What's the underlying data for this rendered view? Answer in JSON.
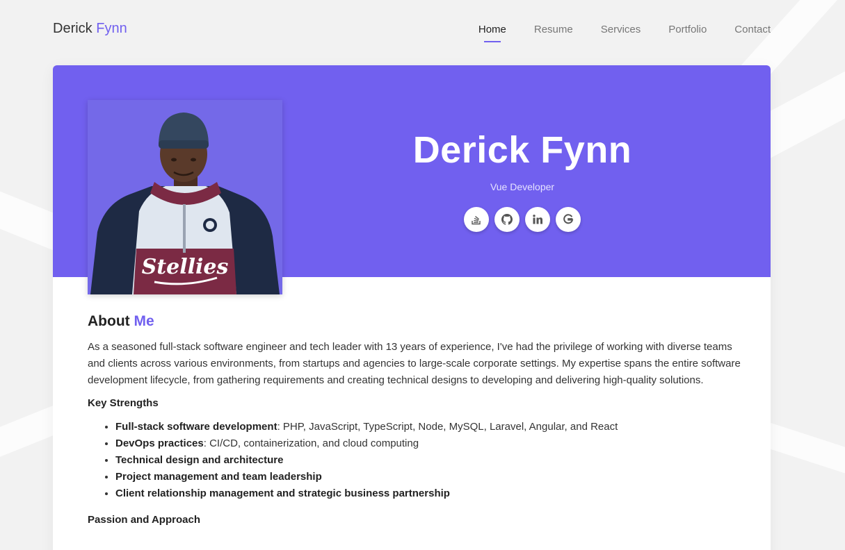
{
  "header": {
    "brand_first": "Derick",
    "brand_last": "Fynn",
    "nav": [
      {
        "label": "Home",
        "active": true
      },
      {
        "label": "Resume",
        "active": false
      },
      {
        "label": "Services",
        "active": false
      },
      {
        "label": "Portfolio",
        "active": false
      },
      {
        "label": "Contact",
        "active": false
      }
    ]
  },
  "hero": {
    "name": "Derick Fynn",
    "role": "Vue Developer",
    "photo_alt": "Stellies",
    "socials": [
      {
        "icon": "stackoverflow-icon"
      },
      {
        "icon": "github-icon"
      },
      {
        "icon": "linkedin-icon"
      },
      {
        "icon": "google-icon"
      }
    ]
  },
  "about": {
    "title_first": "About",
    "title_accent": "Me",
    "intro": "As a seasoned full-stack software engineer and tech leader with 13 years of experience, I've had the privilege of working with diverse teams and clients across various environments, from startups and agencies to large-scale corporate settings. My expertise spans the entire software development lifecycle, from gathering requirements and creating technical designs to developing and delivering high-quality solutions.",
    "strengths_title": "Key Strengths",
    "strengths": [
      {
        "bold": "Full-stack software development",
        "rest": ": PHP, JavaScript, TypeScript, Node, MySQL, Laravel, Angular, and React"
      },
      {
        "bold": "DevOps practices",
        "rest": ": CI/CD, containerization, and cloud computing"
      },
      {
        "bold": "Technical design and architecture",
        "rest": ""
      },
      {
        "bold": "Project management and team leadership",
        "rest": ""
      },
      {
        "bold": "Client relationship management and strategic business partnership",
        "rest": ""
      }
    ],
    "passion_title": "Passion and Approach"
  },
  "colors": {
    "accent": "#7160ef",
    "page_bg": "#f2f2f2"
  }
}
